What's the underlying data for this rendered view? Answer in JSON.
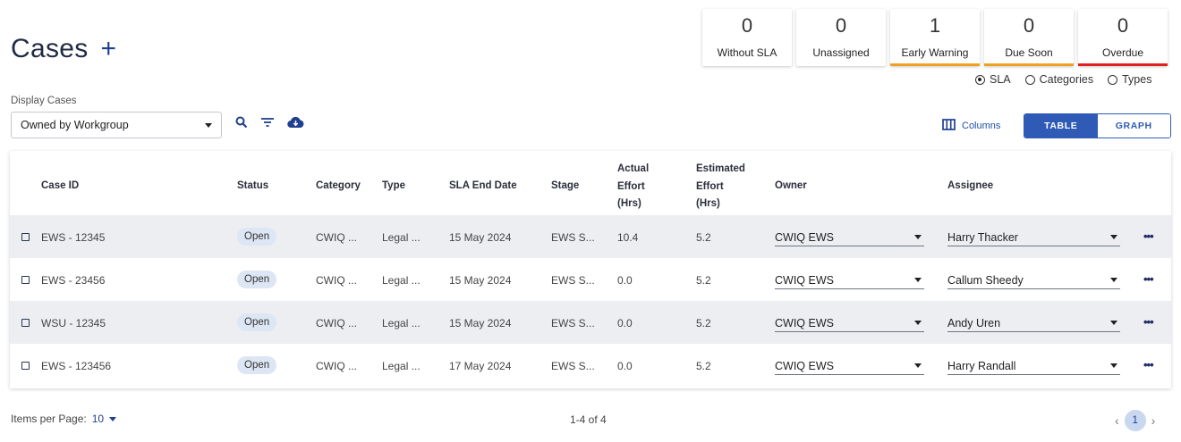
{
  "header": {
    "title": "Cases",
    "add_symbol": "+"
  },
  "stats": [
    {
      "count": "0",
      "label": "Without SLA",
      "bar_color": ""
    },
    {
      "count": "0",
      "label": "Unassigned",
      "bar_color": ""
    },
    {
      "count": "1",
      "label": "Early Warning",
      "bar_color": "#f0a020"
    },
    {
      "count": "0",
      "label": "Due Soon",
      "bar_color": "#f0a020"
    },
    {
      "count": "0",
      "label": "Overdue",
      "bar_color": "#e02020"
    }
  ],
  "view_options": {
    "sla": "SLA",
    "categories": "Categories",
    "types": "Types",
    "selected": "SLA"
  },
  "filter": {
    "label": "Display Cases",
    "value": "Owned by Workgroup"
  },
  "toolbar": {
    "columns_label": "Columns",
    "table_label": "TABLE",
    "graph_label": "GRAPH",
    "active_view": "TABLE"
  },
  "table": {
    "headers": {
      "case_id": "Case ID",
      "status": "Status",
      "category": "Category",
      "type": "Type",
      "sla_end_date": "SLA End Date",
      "stage": "Stage",
      "actual_effort": [
        "Actual",
        "Effort",
        "(Hrs)"
      ],
      "estimated_effort": [
        "Estimated",
        "Effort",
        "(Hrs)"
      ],
      "owner": "Owner",
      "assignee": "Assignee"
    },
    "rows": [
      {
        "case_id": "EWS - 12345",
        "status": "Open",
        "category": "CWIQ ...",
        "type": "Legal ...",
        "sla_end_date": "15 May 2024",
        "stage": "EWS S...",
        "actual_effort": "10.4",
        "estimated_effort": "5.2",
        "owner": "CWIQ EWS",
        "assignee": "Harry Thacker"
      },
      {
        "case_id": "EWS - 23456",
        "status": "Open",
        "category": "CWIQ ...",
        "type": "Legal ...",
        "sla_end_date": "15 May 2024",
        "stage": "EWS S...",
        "actual_effort": "0.0",
        "estimated_effort": "5.2",
        "owner": "CWIQ EWS",
        "assignee": "Callum Sheedy"
      },
      {
        "case_id": "WSU - 12345",
        "status": "Open",
        "category": "CWIQ ...",
        "type": "Legal ...",
        "sla_end_date": "15 May 2024",
        "stage": "EWS S...",
        "actual_effort": "0.0",
        "estimated_effort": "5.2",
        "owner": "CWIQ EWS",
        "assignee": "Andy Uren"
      },
      {
        "case_id": "EWS - 123456",
        "status": "Open",
        "category": "CWIQ ...",
        "type": "Legal ...",
        "sla_end_date": "17 May 2024",
        "stage": "EWS S...",
        "actual_effort": "0.0",
        "estimated_effort": "5.2",
        "owner": "CWIQ EWS",
        "assignee": "Harry Randall"
      }
    ],
    "more_symbol": "•••"
  },
  "pagination": {
    "items_per_page_label": "Items per Page:",
    "items_per_page": "10",
    "range": "1-4 of 4",
    "current_page": "1"
  },
  "icons": [
    "search-icon",
    "filter-icon",
    "cloud-download-icon",
    "columns-icon",
    "chevron-left-icon",
    "chevron-right-icon"
  ]
}
